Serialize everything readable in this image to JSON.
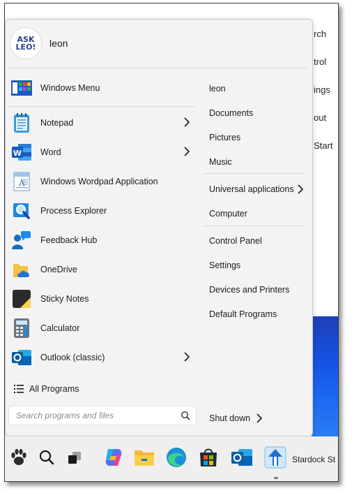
{
  "background": {
    "fragments": [
      "rch",
      "trol",
      "ings",
      "out",
      "Start"
    ]
  },
  "user": {
    "name": "leon",
    "avatar_lines": [
      "ASK",
      "LEO!"
    ]
  },
  "left_items": [
    {
      "label": "Windows Menu",
      "icon": "windows-menu-icon",
      "has_arrow": false
    },
    {
      "label": "Notepad",
      "icon": "notepad-icon",
      "has_arrow": true
    },
    {
      "label": "Word",
      "icon": "word-icon",
      "has_arrow": true
    },
    {
      "label": "Windows Wordpad Application",
      "icon": "wordpad-icon",
      "has_arrow": false
    },
    {
      "label": "Process Explorer",
      "icon": "process-explorer-icon",
      "has_arrow": false
    },
    {
      "label": "Feedback Hub",
      "icon": "feedback-hub-icon",
      "has_arrow": false
    },
    {
      "label": "OneDrive",
      "icon": "onedrive-icon",
      "has_arrow": false
    },
    {
      "label": "Sticky Notes",
      "icon": "sticky-notes-icon",
      "has_arrow": false
    },
    {
      "label": "Calculator",
      "icon": "calculator-icon",
      "has_arrow": false
    },
    {
      "label": "Outlook (classic)",
      "icon": "outlook-icon",
      "has_arrow": true
    }
  ],
  "all_programs": "All Programs",
  "search": {
    "placeholder": "Search programs and files"
  },
  "right_items": [
    {
      "label": "leon"
    },
    {
      "label": "Documents"
    },
    {
      "label": "Pictures"
    },
    {
      "label": "Music"
    },
    {
      "label": "Universal applications"
    },
    {
      "label": "Computer"
    },
    {
      "label": "Control Panel"
    },
    {
      "label": "Settings"
    },
    {
      "label": "Devices and Printers"
    },
    {
      "label": "Default Programs"
    }
  ],
  "shutdown": "Shut down",
  "taskbar": {
    "items": [
      "start-paw-icon",
      "search-icon",
      "task-view-icon",
      "copilot-icon",
      "file-explorer-icon",
      "edge-icon",
      "store-icon",
      "outlook-icon",
      "stardock-icon"
    ],
    "stardock_label": "Stardock St"
  },
  "colors": {
    "menu_bg": "#f3f3f3",
    "accent_blue": "#1f6fd6",
    "taskbar_bg": "#efefef"
  }
}
